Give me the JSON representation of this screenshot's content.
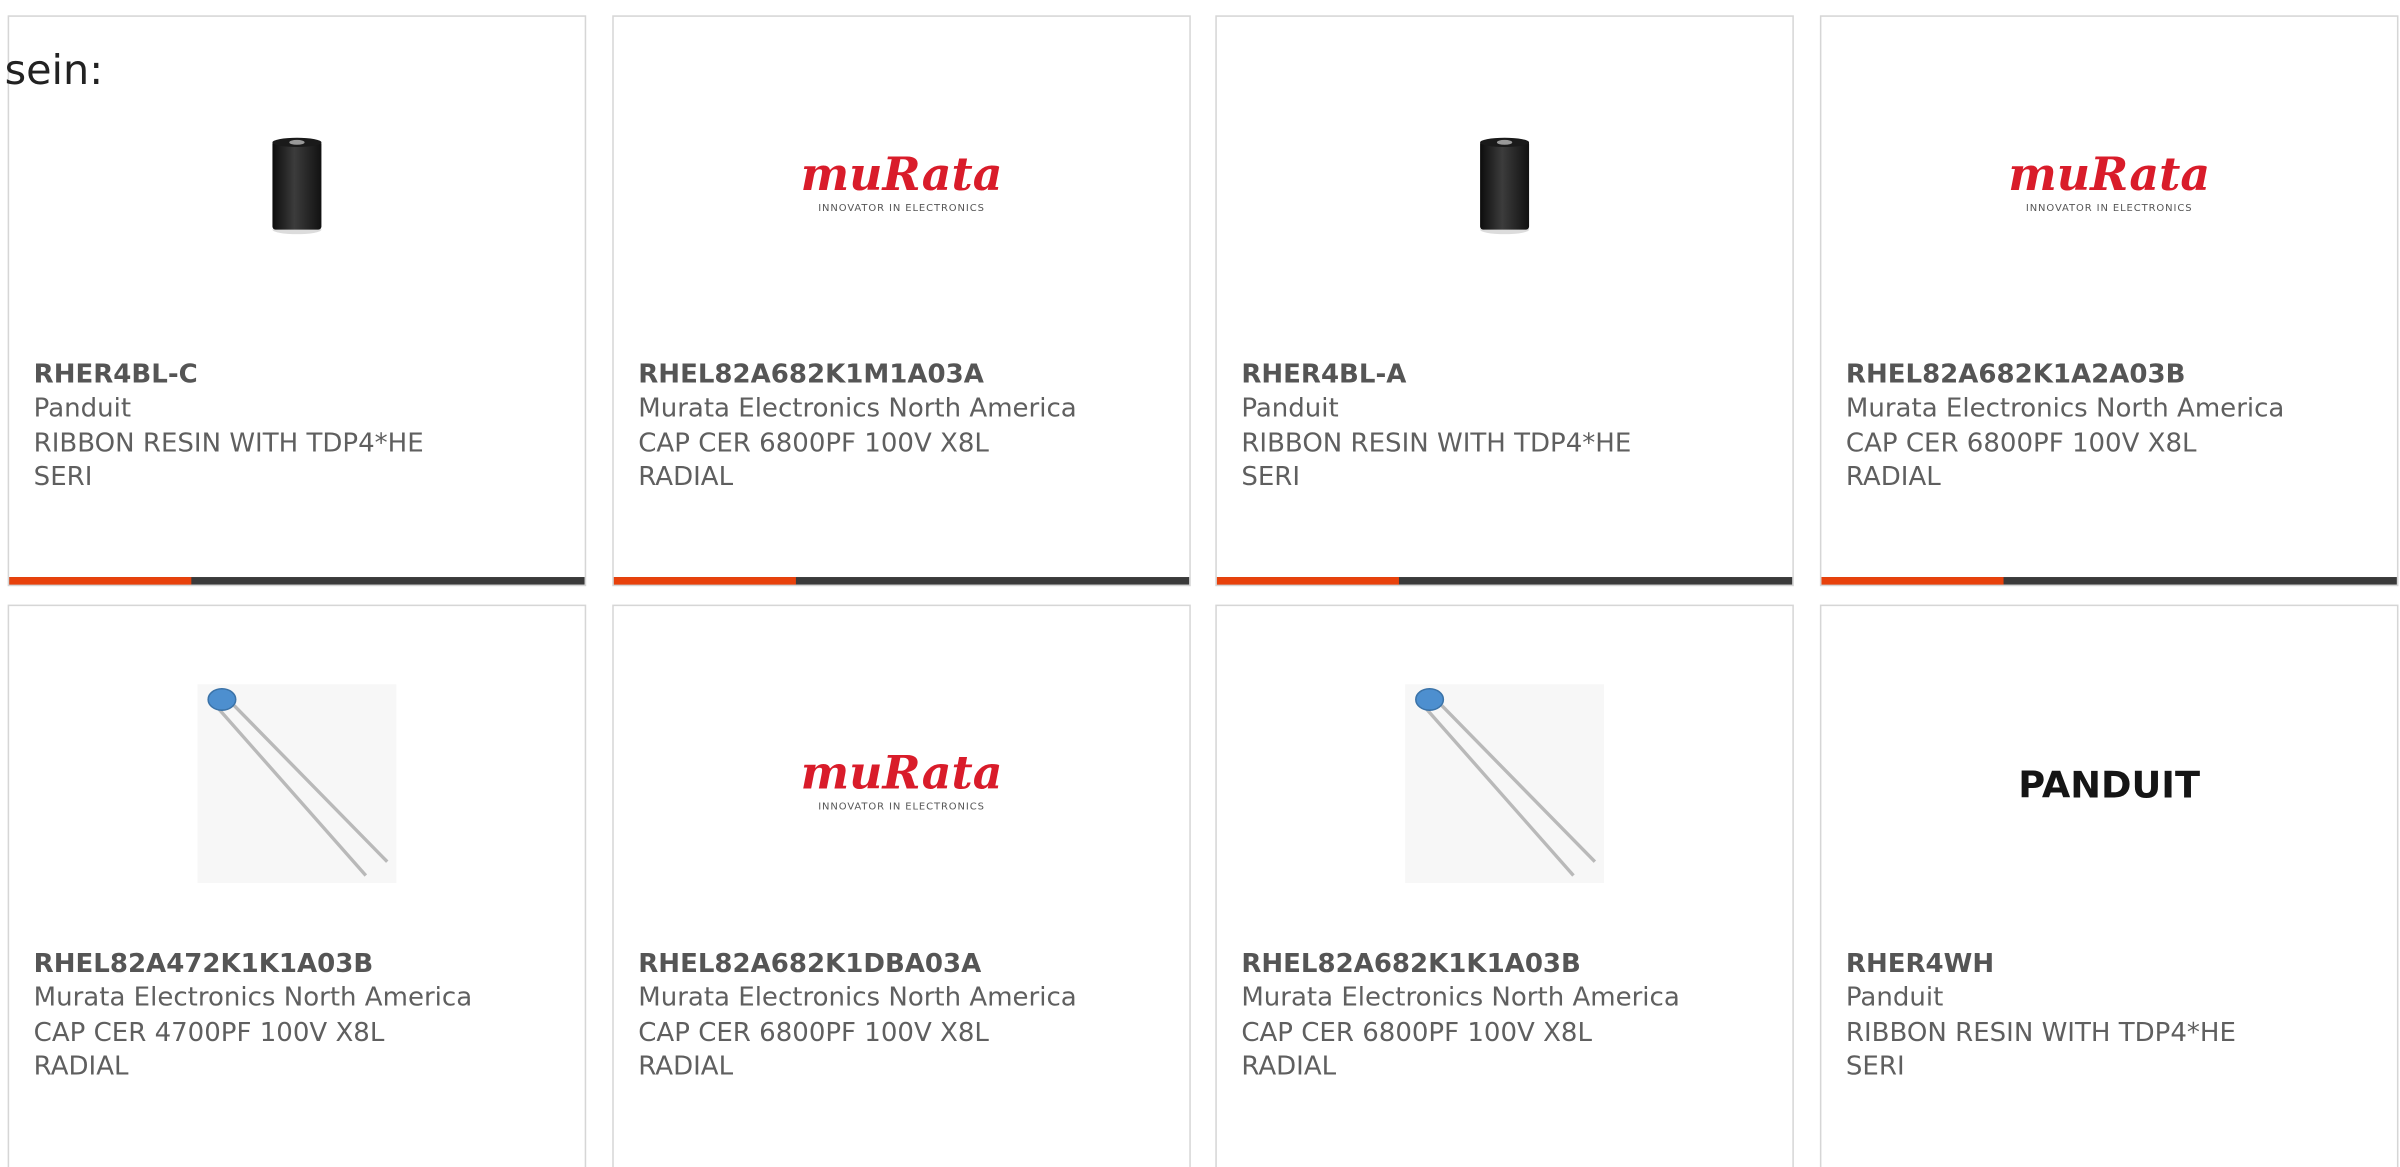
{
  "intro_text": "sein:",
  "colors": {
    "accent": "#e8410b",
    "bar_dark": "#3a3a3a",
    "murata_red": "#d91c2a"
  },
  "products": [
    {
      "part_number": "RHER4BL-C",
      "manufacturer": "Panduit",
      "description": "RIBBON RESIN WITH TDP4*HE SERI",
      "image": "ribbon-roll-image"
    },
    {
      "part_number": "RHEL82A682K1M1A03A",
      "manufacturer": "Murata Electronics North America",
      "description": "CAP CER 6800PF 100V X8L RADIAL",
      "image": "murata-logo"
    },
    {
      "part_number": "RHER4BL-A",
      "manufacturer": "Panduit",
      "description": "RIBBON RESIN WITH TDP4*HE SERI",
      "image": "ribbon-roll-image"
    },
    {
      "part_number": "RHEL82A682K1A2A03B",
      "manufacturer": "Murata Electronics North America",
      "description": "CAP CER 6800PF 100V X8L RADIAL",
      "image": "murata-logo"
    },
    {
      "part_number": "RHEL82A472K1K1A03B",
      "manufacturer": "Murata Electronics North America",
      "description": "CAP CER 4700PF 100V X8L RADIAL",
      "image": "ceramic-capacitor-image"
    },
    {
      "part_number": "RHEL82A682K1DBA03A",
      "manufacturer": "Murata Electronics North America",
      "description": "CAP CER 6800PF 100V X8L RADIAL",
      "image": "murata-logo"
    },
    {
      "part_number": "RHEL82A682K1K1A03B",
      "manufacturer": "Murata Electronics North America",
      "description": "CAP CER 6800PF 100V X8L RADIAL",
      "image": "ceramic-capacitor-image"
    },
    {
      "part_number": "RHER4WH",
      "manufacturer": "Panduit",
      "description": "RIBBON RESIN WITH TDP4*HE SERI",
      "image": "panduit-logo"
    }
  ],
  "logos": {
    "murata_word": "muRata",
    "murata_tagline": "INNOVATOR IN ELECTRONICS",
    "panduit_word": "PANDUIT"
  }
}
